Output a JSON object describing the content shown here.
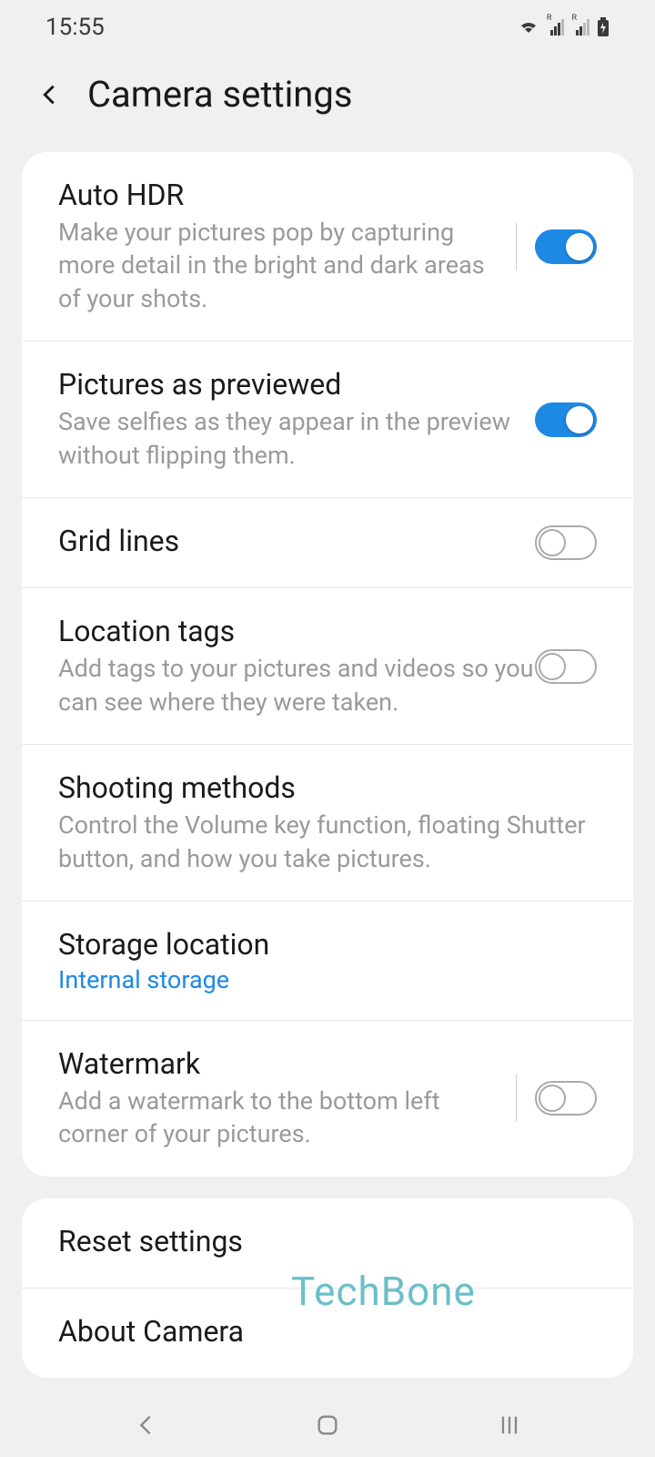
{
  "statusBar": {
    "time": "15:55"
  },
  "header": {
    "title": "Camera settings"
  },
  "settings": [
    {
      "title": "Auto HDR",
      "desc": "Make your pictures pop by capturing more detail in the bright and dark areas of your shots.",
      "toggle": "on",
      "hasDivider": true
    },
    {
      "title": "Pictures as previewed",
      "desc": "Save selfies as they appear in the preview without flipping them.",
      "toggle": "on",
      "hasDivider": false
    },
    {
      "title": "Grid lines",
      "desc": "",
      "toggle": "off",
      "hasDivider": false
    },
    {
      "title": "Location tags",
      "desc": "Add tags to your pictures and videos so you can see where they were taken.",
      "toggle": "off",
      "hasDivider": false
    },
    {
      "title": "Shooting methods",
      "desc": "Control the Volume key function, floating Shutter button, and how you take pictures.",
      "toggle": null,
      "hasDivider": false
    },
    {
      "title": "Storage location",
      "desc": "",
      "value": "Internal storage",
      "toggle": null,
      "hasDivider": false
    },
    {
      "title": "Watermark",
      "desc": "Add a watermark to the bottom left corner of your pictures.",
      "toggle": "off",
      "hasDivider": true
    }
  ],
  "bottomSettings": [
    {
      "title": "Reset settings"
    },
    {
      "title": "About Camera"
    }
  ],
  "watermark": "TechBone"
}
